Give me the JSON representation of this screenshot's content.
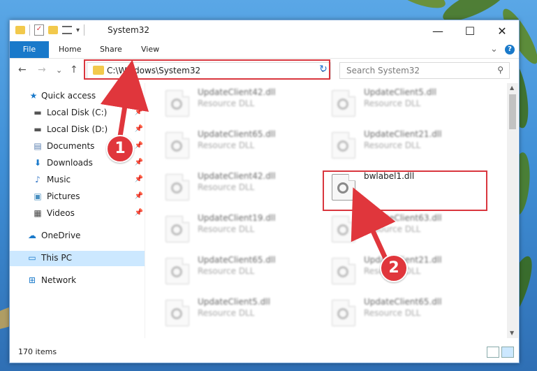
{
  "window": {
    "title": "System32",
    "min_label": "—",
    "max_label": "☐",
    "close_label": "✕"
  },
  "ribbon": {
    "tabs": [
      "File",
      "Home",
      "Share",
      "View"
    ],
    "expand_glyph": "⌄",
    "help_glyph": "?"
  },
  "address": {
    "path": "C:\\Windows\\System32",
    "refresh_glyph": "↻",
    "dropdown_glyph": "⌄"
  },
  "search": {
    "placeholder": "Search System32",
    "icon_glyph": "⚲"
  },
  "nav": {
    "back": "←",
    "forward": "→",
    "recent": "⌄",
    "up": "↑"
  },
  "sidebar": {
    "items": [
      {
        "label": "Quick access",
        "icon": "★"
      },
      {
        "label": "Local Disk (C:)",
        "icon": "▬",
        "pin": "📌"
      },
      {
        "label": "Local Disk (D:)",
        "icon": "▬",
        "pin": "📌"
      },
      {
        "label": "Documents",
        "icon": "▤",
        "pin": "📌"
      },
      {
        "label": "Downloads",
        "icon": "⬇",
        "pin": "📌"
      },
      {
        "label": "Music",
        "icon": "♪",
        "pin": "📌"
      },
      {
        "label": "Pictures",
        "icon": "▣",
        "pin": "📌"
      },
      {
        "label": "Videos",
        "icon": "▦",
        "pin": "📌"
      },
      {
        "label": "OneDrive",
        "icon": "☁"
      },
      {
        "label": "This PC",
        "icon": "▭"
      },
      {
        "label": "Network",
        "icon": "⊞"
      }
    ]
  },
  "files": [
    {
      "name": "UpdateClient42.dll",
      "type": "Resource DLL"
    },
    {
      "name": "UpdateClient5.dll",
      "type": "Resource DLL"
    },
    {
      "name": "UpdateClient65.dll",
      "type": "Resource DLL"
    },
    {
      "name": "UpdateClient21.dll",
      "type": "Resource DLL"
    },
    {
      "name": "UpdateClient42.dll",
      "type": "Resource DLL"
    },
    {
      "name": "bwlabel1.dll",
      "type": ""
    },
    {
      "name": "UpdateClient19.dll",
      "type": "Resource DLL"
    },
    {
      "name": "UpdateClient63.dll",
      "type": "Resource DLL"
    },
    {
      "name": "UpdateClient65.dll",
      "type": "Resource DLL"
    },
    {
      "name": "UpdateClient21.dll",
      "type": "Resource DLL"
    },
    {
      "name": "UpdateClient5.dll",
      "type": "Resource DLL"
    },
    {
      "name": "UpdateClient65.dll",
      "type": "Resource DLL"
    }
  ],
  "status": {
    "count": "170 items"
  },
  "callouts": {
    "one": "1",
    "two": "2"
  },
  "colors": {
    "accent": "#1979ca",
    "highlight": "#d9363e",
    "selected": "#cce8ff"
  }
}
